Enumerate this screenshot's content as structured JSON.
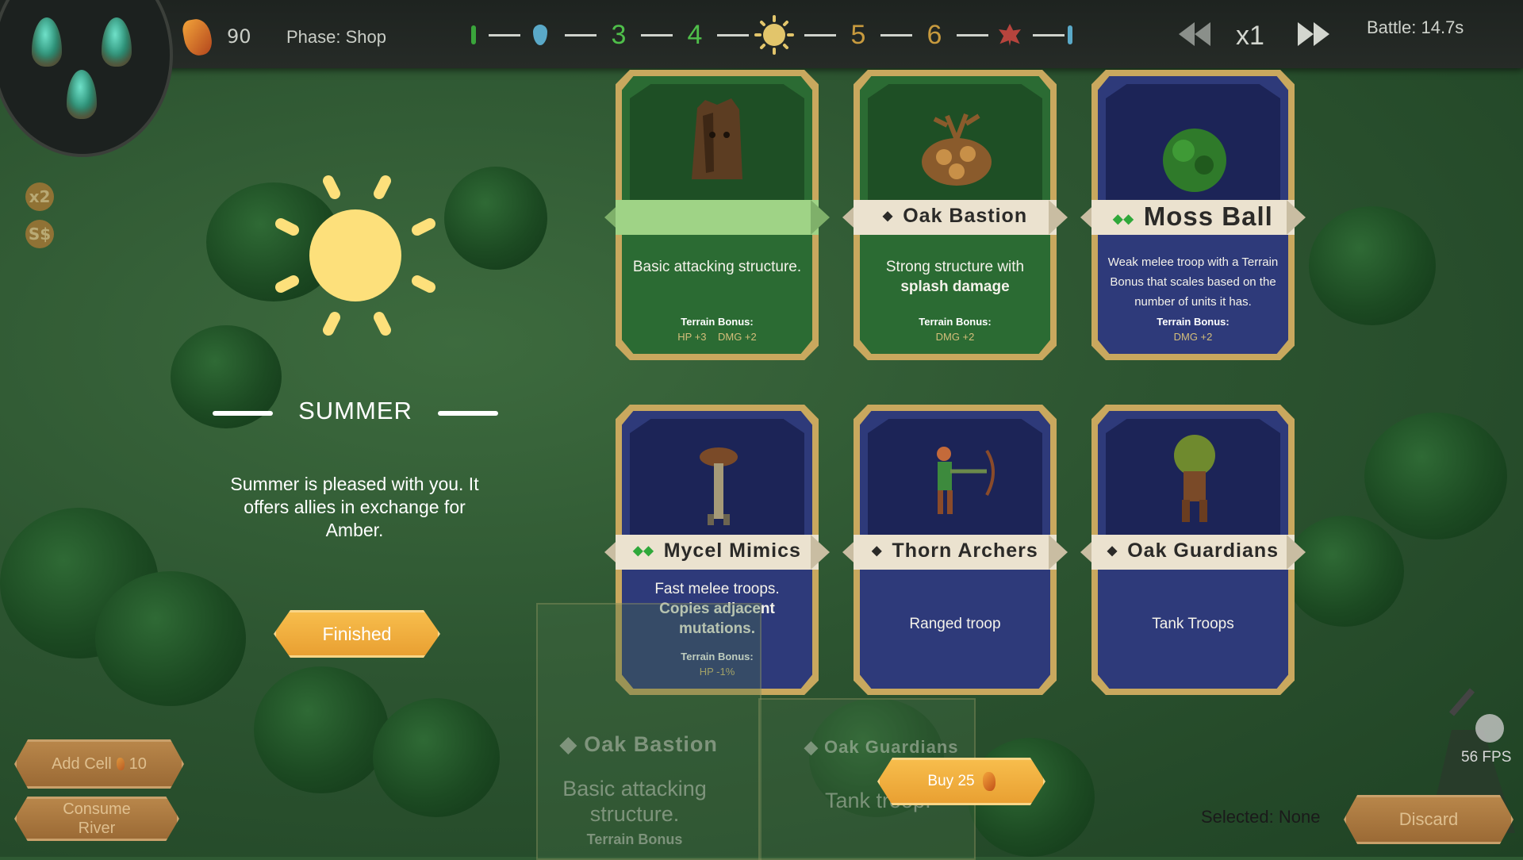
{
  "hud": {
    "amber_count": "90",
    "phase": "Phase: Shop",
    "timeline": {
      "numbers": [
        "3",
        "4",
        "5",
        "6"
      ]
    },
    "speed": "x1",
    "battle_time": "Battle: 14.7s",
    "multiplier_badge": "x2",
    "currency_badge": "S$"
  },
  "season": {
    "title": "SUMMER",
    "description": "Summer is pleased with you. It offers allies in exchange for Amber.",
    "finished_label": "Finished"
  },
  "shop_cards": [
    {
      "name": "",
      "style": "green",
      "description": "Basic attacking structure.",
      "terrain_bonus_label": "Terrain Bonus:",
      "terrain_bonus": "HP +3    DMG +2"
    },
    {
      "name": "Oak Bastion",
      "style": "green",
      "description_plain": "Strong structure with",
      "description_bold": "splash damage",
      "terrain_bonus_label": "Terrain Bonus:",
      "terrain_bonus": "DMG +2"
    },
    {
      "name": "Moss Ball",
      "style": "blue",
      "description": "Weak melee troop with a Terrain Bonus that scales based on the number of units it has.",
      "terrain_bonus_label": "Terrain Bonus:",
      "terrain_bonus": "DMG +2"
    },
    {
      "name": "Mycel Mimics",
      "style": "blue",
      "description_plain": "Fast melee troops.",
      "description_bold": "Copies adjacent mutations.",
      "terrain_bonus_label": "Terrain Bonus:",
      "terrain_bonus": "HP -1%"
    },
    {
      "name": "Thorn Archers",
      "style": "blue",
      "description": "Ranged troop"
    },
    {
      "name": "Oak Guardians",
      "style": "blue",
      "description": "Tank Troops"
    }
  ],
  "hand": {
    "card1_name": "Oak Bastion",
    "card1_desc": "Basic attacking structure.",
    "card1_bonus": "Terrain Bonus",
    "card2_name": "Oak Guardians",
    "card2_desc": "Tank troop."
  },
  "buttons": {
    "add_cell": "Add Cell",
    "add_cell_cost": "10",
    "consume_river": "Consume River",
    "buy": "Buy 25",
    "discard": "Discard"
  },
  "status": {
    "fps": "56 FPS",
    "selected": "Selected: None"
  },
  "colors": {
    "accent_amber": "#f0ab3c",
    "card_green": "#2b6b33",
    "card_blue": "#2e3a7a",
    "timeline_green": "#4fbf4a",
    "timeline_amber": "#c79a3e"
  }
}
